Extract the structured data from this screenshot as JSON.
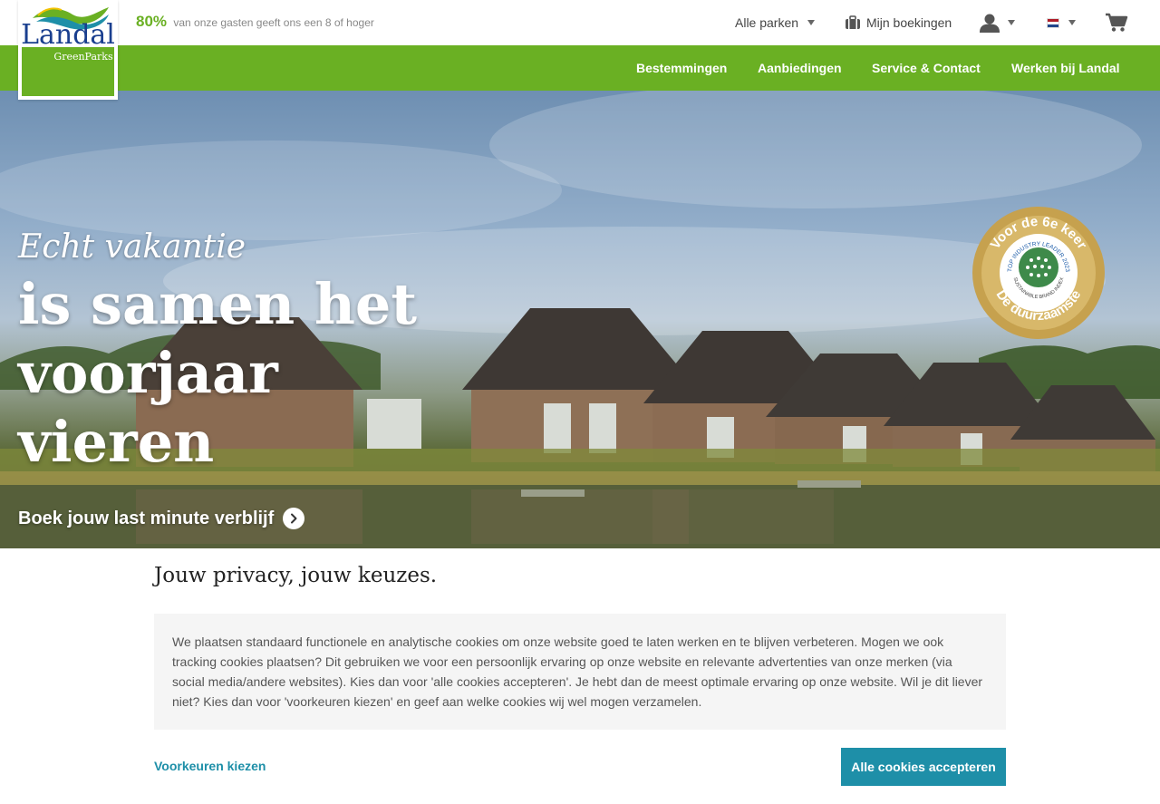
{
  "top_bar": {
    "rating_percent": "80%",
    "rating_text": "van onze gasten geeft ons een 8 of hoger",
    "parks_dropdown": "Alle parken",
    "bookings_label": "Mijn boekingen",
    "language": "NL"
  },
  "logo": {
    "brand": "Landal",
    "sub": "GreenParks"
  },
  "nav": {
    "items": [
      {
        "label": "Bestemmingen"
      },
      {
        "label": "Aanbiedingen"
      },
      {
        "label": "Service & Contact"
      },
      {
        "label": "Werken bij Landal"
      }
    ]
  },
  "hero": {
    "script_line": "Echt vakantie",
    "title_lines": [
      "is samen het",
      "voorjaar",
      "vieren"
    ],
    "cta": "Boek jouw last minute verblijf",
    "badge": {
      "top_text": "Voor de 6e keer",
      "line1": "TOP INDUSTRY LEADER 2023",
      "line2": "SUSTAINABLE BRAND INDEX",
      "bottom_text": "De duurzaamste"
    }
  },
  "privacy": {
    "title": "Jouw privacy, jouw keuzes.",
    "body": "We plaatsen standaard functionele en analytische cookies om onze website goed te laten werken en te blijven verbeteren. Mogen we ook tracking cookies plaatsen? Dit gebruiken we voor een persoonlijk ervaring op onze website en relevante advertenties van onze merken (via social media/andere websites). Kies dan voor 'alle cookies accepteren'. Je hebt dan de meest optimale ervaring op onze website. Wil je dit liever niet? Kies dan voor 'voorkeuren kiezen' en geef aan welke cookies wij wel mogen verzamelen.",
    "preferences_link": "Voorkeuren kiezen",
    "accept_button": "Alle cookies accepteren"
  },
  "colors": {
    "brand_green": "#6ab023",
    "accent_teal": "#1e8fa8",
    "logo_blue": "#1a3f8f"
  }
}
